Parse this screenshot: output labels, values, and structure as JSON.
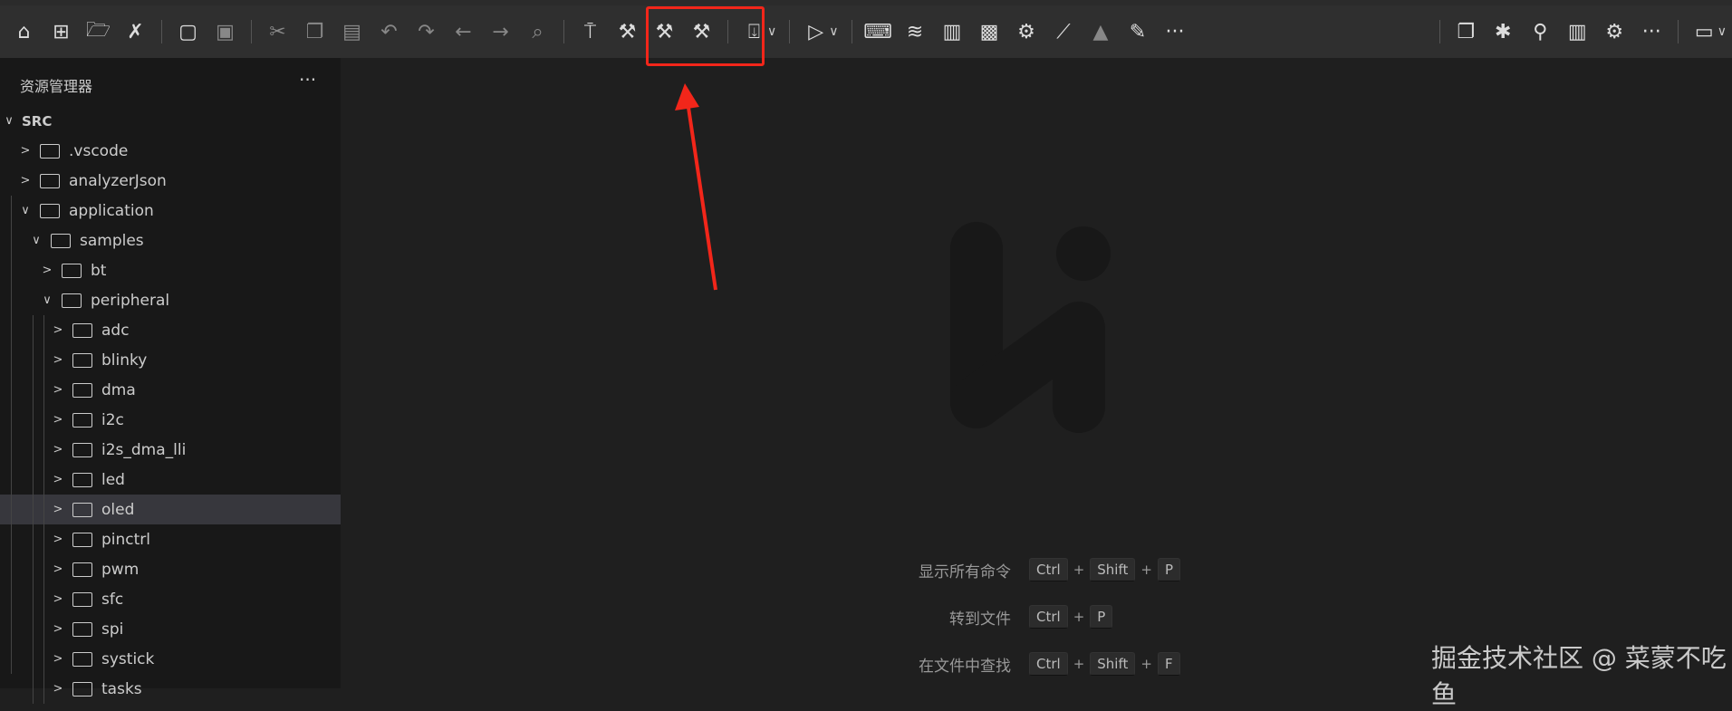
{
  "toolbar": {
    "items": [
      {
        "n": "home-icon",
        "g": "⌂"
      },
      {
        "n": "new-file-icon",
        "g": "⊞"
      },
      {
        "n": "open-folder-icon",
        "g": "🗁"
      },
      {
        "n": "tools-icon",
        "g": "✗"
      },
      {
        "sep": 1
      },
      {
        "n": "new-document-icon",
        "g": "▢"
      },
      {
        "n": "save-icon",
        "g": "▣",
        "d": 1
      },
      {
        "sep": 1
      },
      {
        "n": "cut-icon",
        "g": "✂",
        "d": 1
      },
      {
        "n": "copy-icon",
        "g": "❐",
        "d": 1
      },
      {
        "n": "paste-icon",
        "g": "▤",
        "d": 1
      },
      {
        "n": "undo-icon",
        "g": "↶",
        "d": 1
      },
      {
        "n": "redo-icon",
        "g": "↷",
        "d": 1
      },
      {
        "n": "back-icon",
        "g": "←",
        "d": 1
      },
      {
        "n": "forward-icon",
        "g": "→",
        "d": 1
      },
      {
        "n": "find-icon",
        "g": "⌕",
        "d": 1
      },
      {
        "sep": 1
      },
      {
        "n": "clean-icon",
        "g": "⍑"
      },
      {
        "n": "build-icon",
        "g": "⚒"
      },
      {
        "n": "rebuild-icon",
        "g": "⚒"
      },
      {
        "n": "build-clean-icon",
        "g": "⚒"
      },
      {
        "sep": 1
      },
      {
        "n": "download-icon",
        "g": "⍗",
        "c": 1
      },
      {
        "sep": 1
      },
      {
        "n": "debug-run-icon",
        "g": "▷",
        "c": 1
      },
      {
        "sep": 1
      },
      {
        "n": "terminal-icon",
        "g": "⌨"
      },
      {
        "n": "layers-icon",
        "g": "≋"
      },
      {
        "n": "stats-icon",
        "g": "▥"
      },
      {
        "n": "chip-icon",
        "g": "▩"
      },
      {
        "n": "config-icon",
        "g": "⚙"
      },
      {
        "n": "line-chart-icon",
        "g": "⟋"
      },
      {
        "n": "fire-icon",
        "g": "▲",
        "d": 1
      },
      {
        "n": "edit-window-icon",
        "g": "✎"
      },
      {
        "n": "more-icon",
        "g": "···"
      }
    ],
    "right": [
      {
        "n": "explorer-icon",
        "g": "❐"
      },
      {
        "n": "bug-icon",
        "g": "✱"
      },
      {
        "n": "search-icon",
        "g": "⚲"
      },
      {
        "n": "analysis-icon",
        "g": "▥"
      },
      {
        "n": "settings-icon",
        "g": "⚙"
      },
      {
        "n": "more-icon",
        "g": "···"
      },
      {
        "sep": 1
      },
      {
        "n": "layout-icon",
        "g": "▭",
        "c": 1
      }
    ]
  },
  "sidebar": {
    "title": "资源管理器",
    "more": "···",
    "root": "SRC",
    "tree": [
      {
        "label": ".vscode",
        "depth": 1,
        "open": false
      },
      {
        "label": "analyzerJson",
        "depth": 1,
        "open": false
      },
      {
        "label": "application",
        "depth": 1,
        "open": true
      },
      {
        "label": "samples",
        "depth": 2,
        "open": true
      },
      {
        "label": "bt",
        "depth": 3,
        "open": false
      },
      {
        "label": "peripheral",
        "depth": 3,
        "open": true
      },
      {
        "label": "adc",
        "depth": 4,
        "open": false
      },
      {
        "label": "blinky",
        "depth": 4,
        "open": false
      },
      {
        "label": "dma",
        "depth": 4,
        "open": false
      },
      {
        "label": "i2c",
        "depth": 4,
        "open": false
      },
      {
        "label": "i2s_dma_lli",
        "depth": 4,
        "open": false
      },
      {
        "label": "led",
        "depth": 4,
        "open": false
      },
      {
        "label": "oled",
        "depth": 4,
        "open": false,
        "selected": true
      },
      {
        "label": "pinctrl",
        "depth": 4,
        "open": false
      },
      {
        "label": "pwm",
        "depth": 4,
        "open": false
      },
      {
        "label": "sfc",
        "depth": 4,
        "open": false
      },
      {
        "label": "spi",
        "depth": 4,
        "open": false
      },
      {
        "label": "systick",
        "depth": 4,
        "open": false
      },
      {
        "label": "tasks",
        "depth": 4,
        "open": false
      }
    ]
  },
  "main": {
    "shortcuts": [
      {
        "label": "显示所有命令",
        "keys": [
          "Ctrl",
          "Shift",
          "P"
        ]
      },
      {
        "label": "转到文件",
        "keys": [
          "Ctrl",
          "P"
        ]
      },
      {
        "label": "在文件中查找",
        "keys": [
          "Ctrl",
          "Shift",
          "F"
        ]
      }
    ],
    "plus": "+"
  },
  "watermark": "掘金技术社区 @ 菜蒙不吃鱼",
  "annotation_color": "#f2261a"
}
